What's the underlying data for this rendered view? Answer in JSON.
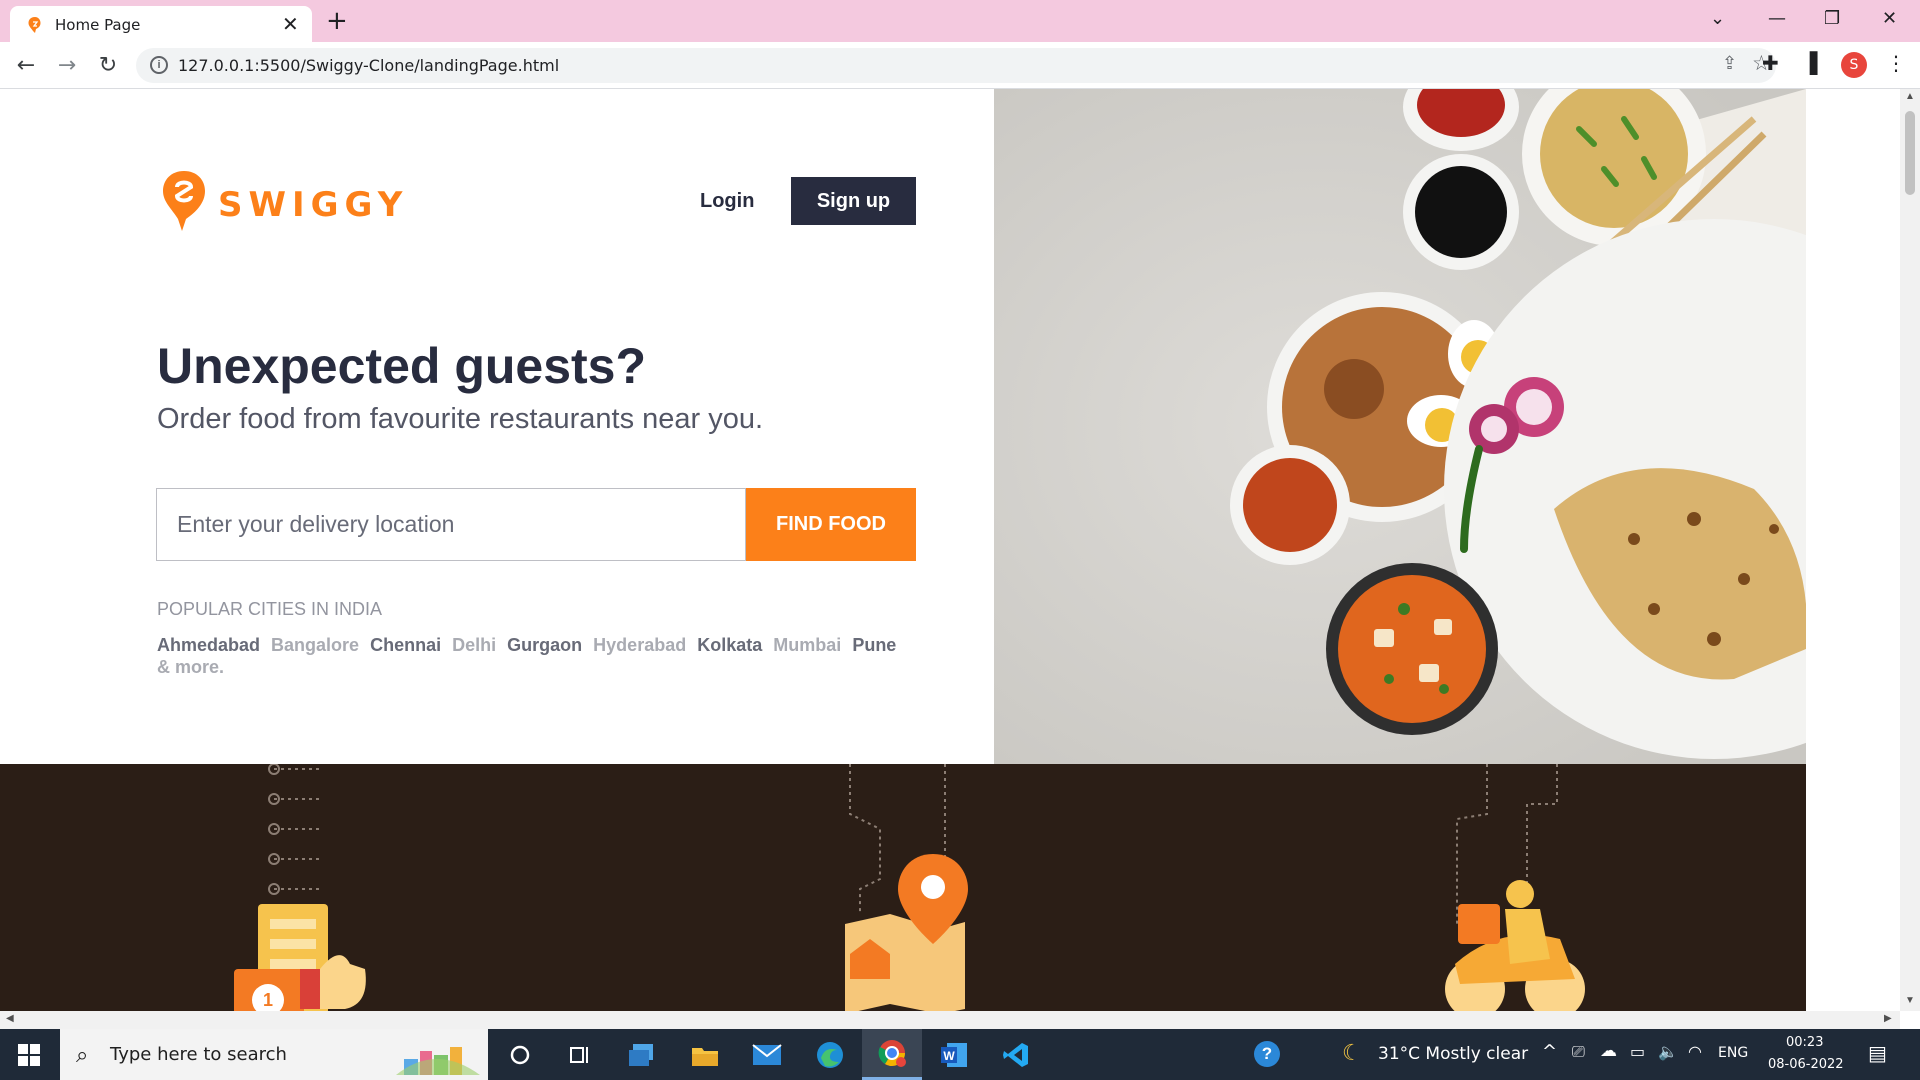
{
  "browser": {
    "tab_title": "Home Page",
    "tab_close": "✕",
    "new_tab": "+",
    "url": "127.0.0.1:5500/Swiggy-Clone/landingPage.html",
    "window_controls": {
      "tab_search": "⌄",
      "minimize": "—",
      "restore": "❐",
      "close": "✕"
    },
    "nav": {
      "back": "←",
      "forward": "→",
      "reload": "↻"
    },
    "profile_initial": "S"
  },
  "page": {
    "logo_text": "SWIGGY",
    "login": "Login",
    "signup": "Sign up",
    "headline": "Unexpected guests?",
    "subheadline": "Order food from favourite restaurants near you.",
    "search": {
      "placeholder": "Enter your delivery location",
      "button": "FIND FOOD"
    },
    "popular_title": "POPULAR CITIES IN INDIA",
    "cities": [
      {
        "name": "Ahmedabad",
        "tone": "dark"
      },
      {
        "name": "Bangalore",
        "tone": "light"
      },
      {
        "name": "Chennai",
        "tone": "dark"
      },
      {
        "name": "Delhi",
        "tone": "light"
      },
      {
        "name": "Gurgaon",
        "tone": "dark"
      },
      {
        "name": "Hyderabad",
        "tone": "light"
      },
      {
        "name": "Kolkata",
        "tone": "dark"
      },
      {
        "name": "Mumbai",
        "tone": "light"
      },
      {
        "name": "Pune",
        "tone": "dark"
      },
      {
        "name": "& more.",
        "tone": "light"
      }
    ],
    "band_badge": "1"
  },
  "taskbar": {
    "search_placeholder": "Type here to search",
    "weather": "31°C  Mostly clear",
    "language": "ENG",
    "time": "00:23",
    "date": "08-06-2022",
    "help": "?"
  },
  "colors": {
    "brand_orange": "#fc8019",
    "dark_navy": "#282c3f",
    "band_brown": "#2b1e16",
    "tab_strip_pink": "#f4c9df",
    "taskbar": "#1f2a38"
  }
}
